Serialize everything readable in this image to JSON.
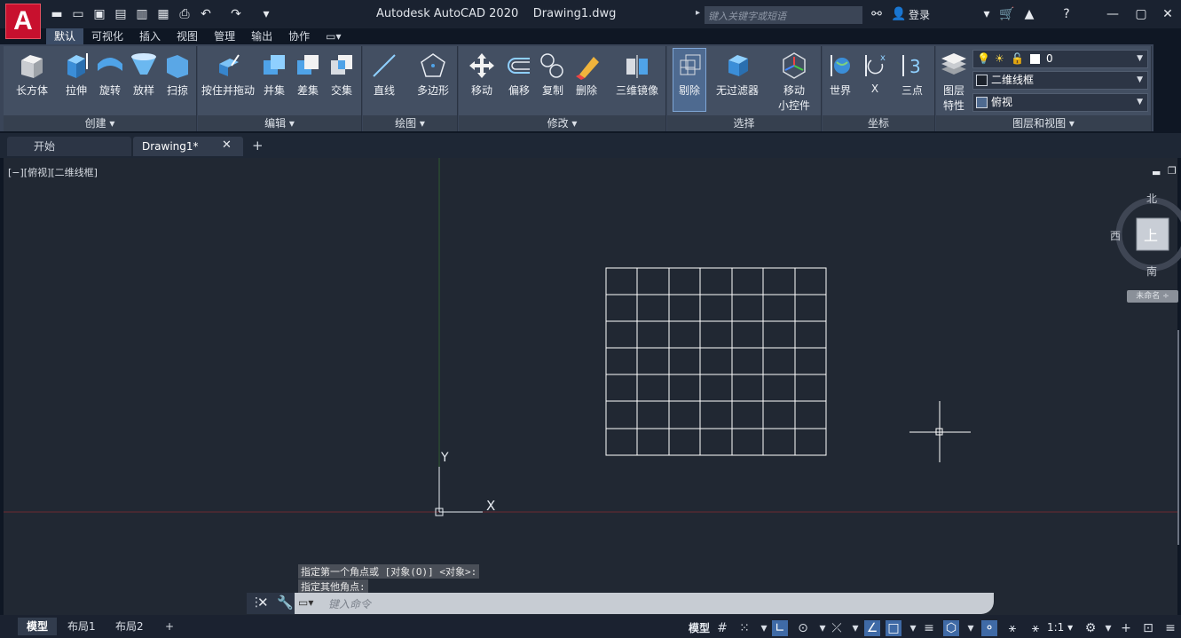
{
  "window": {
    "title": "Autodesk AutoCAD 2020",
    "file": "Drawing1.dwg"
  },
  "app_logo": "A",
  "search": {
    "placeholder": "键入关键字或短语"
  },
  "login_label": "登录",
  "menu_tabs": [
    "默认",
    "可视化",
    "插入",
    "视图",
    "管理",
    "输出",
    "协作"
  ],
  "ribbon": {
    "create": {
      "title": "创建",
      "tools": [
        "长方体",
        "拉伸",
        "旋转",
        "放样",
        "扫掠"
      ]
    },
    "edit": {
      "title": "编辑",
      "tools": [
        "按住并拖动",
        "并集",
        "差集",
        "交集"
      ]
    },
    "draw": {
      "title": "绘图",
      "tools": [
        "直线",
        "多边形"
      ]
    },
    "modify": {
      "title": "修改",
      "tools": [
        "移动",
        "偏移",
        "复制",
        "删除",
        "三维镜像"
      ]
    },
    "selection": {
      "title": "选择",
      "tools": [
        "剔除",
        "无过滤器",
        "移动",
        "小控件"
      ]
    },
    "coordinates": {
      "title": "坐标",
      "tools": [
        "世界",
        "X",
        "三点"
      ]
    },
    "layers": {
      "title": "图层和视图",
      "tool_line1": "图层",
      "tool_line2": "特性",
      "layer_value": "0",
      "visual_style": "二维线框",
      "view": "俯视"
    }
  },
  "file_tabs": {
    "start": "开始",
    "drawing": "Drawing1*"
  },
  "viewport_label": "[−][俯视][二维线框]",
  "viewcube": {
    "north": "北",
    "south": "南",
    "west": "西",
    "face": "上",
    "wcs": "未命名 ÷"
  },
  "ucs": {
    "x": "X",
    "y": "Y"
  },
  "command": {
    "history": [
      "指定第一个角点或 [对象(O)] <对象>:",
      "指定其他角点:"
    ],
    "placeholder": "键入命令"
  },
  "layout_tabs": [
    "模型",
    "布局1",
    "布局2"
  ],
  "status": {
    "model_label": "模型",
    "scale": "1:1"
  },
  "colors": {
    "background": "#212833",
    "ribbon": "#434f62",
    "accent": "#3f6aa6"
  }
}
